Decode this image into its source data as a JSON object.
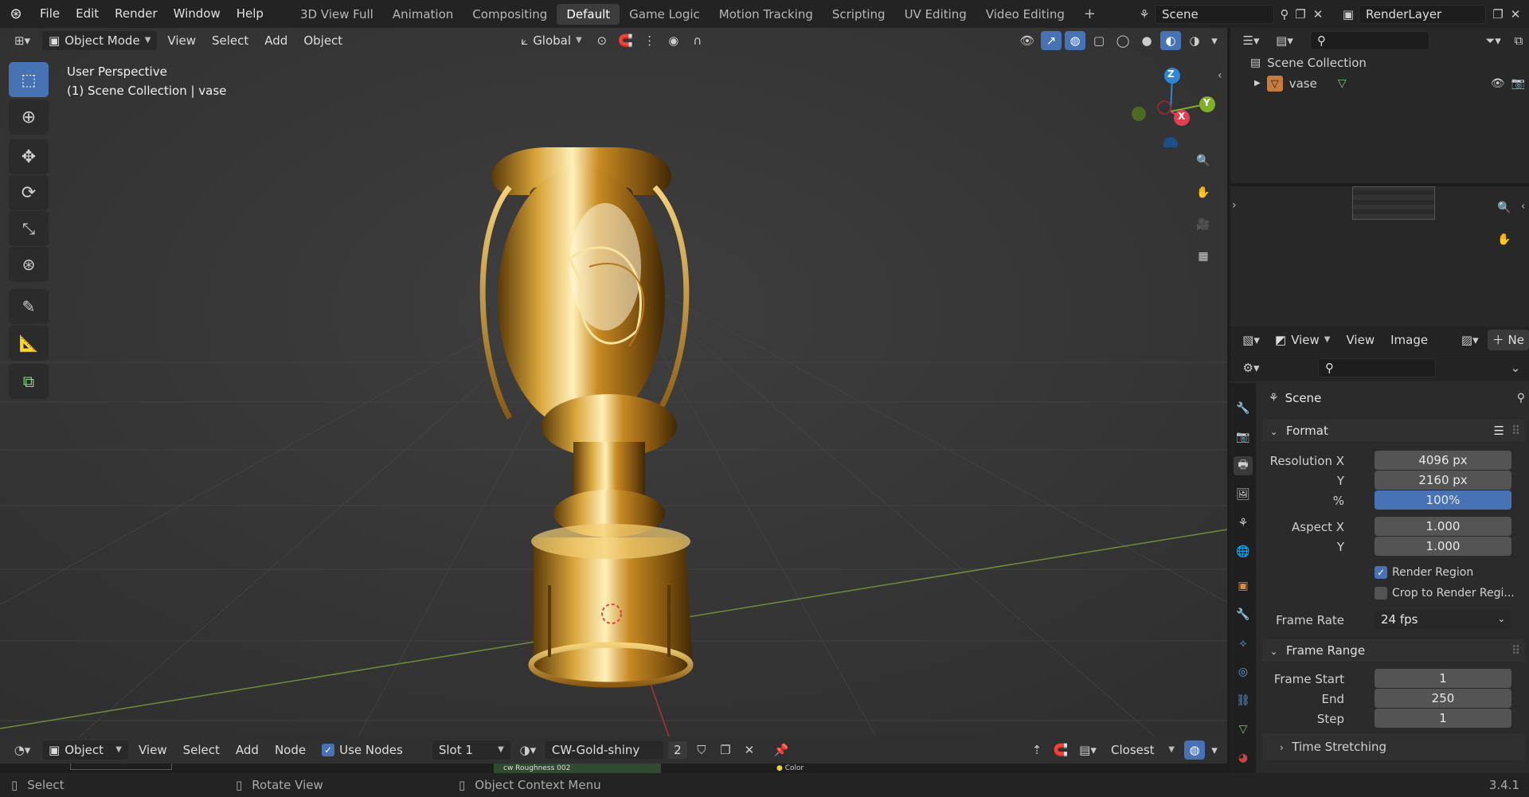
{
  "topbar": {
    "menus": [
      "File",
      "Edit",
      "Render",
      "Window",
      "Help"
    ],
    "workspaces": [
      "3D View Full",
      "Animation",
      "Compositing",
      "Default",
      "Game Logic",
      "Motion Tracking",
      "Scripting",
      "UV Editing",
      "Video Editing"
    ],
    "active_workspace": "Default",
    "add_workspace": "+",
    "scene": "Scene",
    "view_layer": "RenderLayer"
  },
  "viewport_header": {
    "mode": "Object Mode",
    "menus": [
      "View",
      "Select",
      "Add",
      "Object"
    ],
    "transform_orientation": "Global"
  },
  "viewport": {
    "perspective_label": "User Perspective",
    "collection_label": "(1) Scene Collection | vase",
    "gizmo": {
      "z": "Z",
      "x": "X",
      "y": "Y"
    }
  },
  "outliner": {
    "root": "Scene Collection",
    "items": [
      {
        "name": "vase",
        "icon": "object-icon"
      }
    ]
  },
  "image_editor": {
    "menus": [
      "View",
      "View",
      "Image"
    ],
    "new_label": "Ne"
  },
  "properties": {
    "context": "Scene",
    "format_panel": {
      "title": "Format",
      "resolution_x_label": "Resolution X",
      "resolution_x": "4096 px",
      "resolution_y_label": "Y",
      "resolution_y": "2160 px",
      "percent_label": "%",
      "percent": "100%",
      "percent_fraction": 1.0,
      "aspect_x_label": "Aspect X",
      "aspect_x": "1.000",
      "aspect_y_label": "Y",
      "aspect_y": "1.000",
      "render_region_label": "Render Region",
      "render_region_checked": true,
      "crop_label": "Crop to Render Regi...",
      "crop_checked": false,
      "frame_rate_label": "Frame Rate",
      "frame_rate": "24 fps"
    },
    "frame_range_panel": {
      "title": "Frame Range",
      "start_label": "Frame Start",
      "start": "1",
      "end_label": "End",
      "end": "250",
      "step_label": "Step",
      "step": "1"
    },
    "time_stretching": "Time Stretching"
  },
  "node_editor_header": {
    "type": "Object",
    "menus": [
      "View",
      "Select",
      "Add",
      "Node"
    ],
    "use_nodes_label": "Use Nodes",
    "slot": "Slot 1",
    "material": "CW-Gold-shiny",
    "users": "2",
    "snap": "Closest",
    "node_label_fragment1": "cw Roughness 002",
    "node_label_fragment2": "Color"
  },
  "statusbar": {
    "select": "Select",
    "rotate": "Rotate View",
    "context_menu": "Object Context Menu",
    "version": "3.4.1"
  },
  "colors": {
    "accent": "#4772b3",
    "gizmo_x": "#e04050",
    "gizmo_y": "#7fb02a",
    "gizmo_z": "#2f86d8",
    "gold": "#d9a53b"
  }
}
